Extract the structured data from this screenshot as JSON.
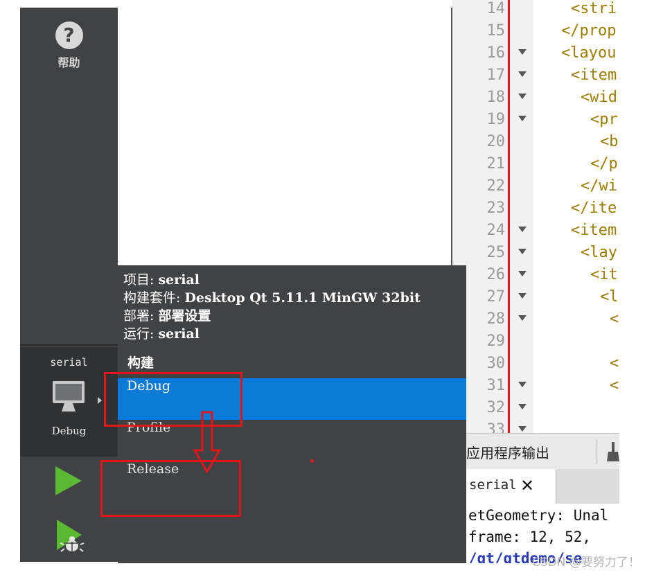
{
  "sidebar": {
    "help_label": "帮助",
    "help_icon": "?",
    "target": {
      "project": "serial",
      "config": "Debug"
    }
  },
  "popup": {
    "project_label": "项目: ",
    "project_value": "serial",
    "kit_label": "构建套件: ",
    "kit_value": "Desktop Qt 5.11.1 MinGW 32bit",
    "deploy_label": "部署: ",
    "deploy_value": "部署设置",
    "run_label": "运行: ",
    "run_value": "serial",
    "build_heading": "构建",
    "configs": [
      {
        "label": "Debug",
        "selected": true
      },
      {
        "label": "Profile",
        "selected": false
      },
      {
        "label": "Release",
        "selected": false
      }
    ]
  },
  "editor": {
    "line_numbers": [
      "14",
      "15",
      "16",
      "17",
      "18",
      "19",
      "20",
      "21",
      "22",
      "23",
      "24",
      "25",
      "26",
      "27",
      "28",
      "29",
      "30",
      "31",
      "32",
      "33"
    ],
    "code_lines": [
      "<stri",
      "</prop",
      "<layou",
      "<item",
      "<wid",
      "<pr",
      "<b",
      "</p",
      "</wi",
      "</ite",
      "<item",
      "<lay",
      "<it",
      "<l",
      "<",
      "<",
      "<"
    ]
  },
  "output": {
    "title": "应用程序输出",
    "tab_label": "serial",
    "lines": [
      "etGeometry: Unal",
      "frame: 12, 52,",
      "/qt/qtdemo/se"
    ]
  },
  "watermark": "CSDN @要努力了！",
  "colors": {
    "sidebar": "#404244",
    "selection": "#0b7ad6",
    "annotation": "#e0161b",
    "run_green": "#5bb833"
  }
}
